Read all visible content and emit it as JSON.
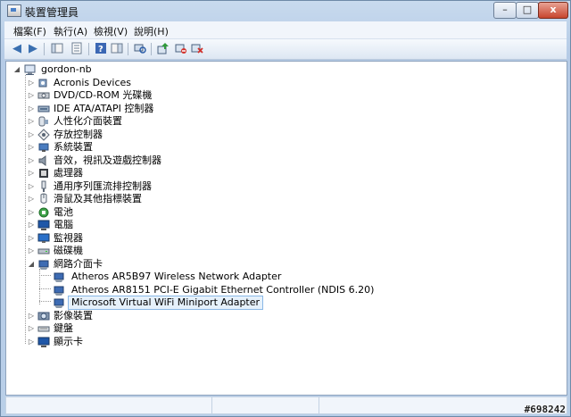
{
  "window": {
    "title": "裝置管理員",
    "minimize_glyph": "–",
    "maximize_glyph": "□",
    "close_glyph": "x"
  },
  "menu": [
    "檔案(F)",
    "執行(A)",
    "檢視(V)",
    "說明(H)"
  ],
  "toolbar": {
    "back_glyph": "◀",
    "forward_glyph": "▶",
    "items": [
      "show-hide-tree-icon",
      "properties-icon",
      "help-icon",
      "action-pane-icon",
      "scan-hardware-icon",
      "update-driver-icon",
      "disable-device-icon",
      "uninstall-device-icon"
    ]
  },
  "tree": {
    "root": "gordon-nb",
    "nodes": [
      {
        "label": "Acronis Devices",
        "expand": "▷"
      },
      {
        "label": "DVD/CD-ROM 光碟機",
        "expand": "▷"
      },
      {
        "label": "IDE ATA/ATAPI 控制器",
        "expand": "▷"
      },
      {
        "label": "人性化介面裝置",
        "expand": "▷"
      },
      {
        "label": "存放控制器",
        "expand": "▷"
      },
      {
        "label": "系統裝置",
        "expand": "▷"
      },
      {
        "label": "音效，視訊及遊戲控制器",
        "expand": "▷"
      },
      {
        "label": "處理器",
        "expand": "▷"
      },
      {
        "label": "通用序列匯流排控制器",
        "expand": "▷"
      },
      {
        "label": "滑鼠及其他指標裝置",
        "expand": "▷"
      },
      {
        "label": "電池",
        "expand": "▷"
      },
      {
        "label": "電腦",
        "expand": "▷"
      },
      {
        "label": "監視器",
        "expand": "▷"
      },
      {
        "label": "磁碟機",
        "expand": "▷"
      },
      {
        "label": "網路介面卡",
        "expand": "◢"
      },
      {
        "label": "Atheros AR5B97 Wireless Network Adapter",
        "expand": ""
      },
      {
        "label": "Atheros AR8151 PCI-E Gigabit Ethernet Controller (NDIS 6.20)",
        "expand": ""
      },
      {
        "label": "Microsoft Virtual WiFi Miniport Adapter",
        "expand": ""
      },
      {
        "label": "影像裝置",
        "expand": "▷"
      },
      {
        "label": "鍵盤",
        "expand": "▷"
      },
      {
        "label": "顯示卡",
        "expand": "▷"
      }
    ]
  },
  "watermark": "#698242",
  "icon_glyphs": {
    "root": "🖥",
    "device": "▪"
  },
  "colors": {
    "selection_border": "#8ab8e6",
    "selection_fill": "#e6f1fb",
    "chrome": "#b9cfe8"
  }
}
